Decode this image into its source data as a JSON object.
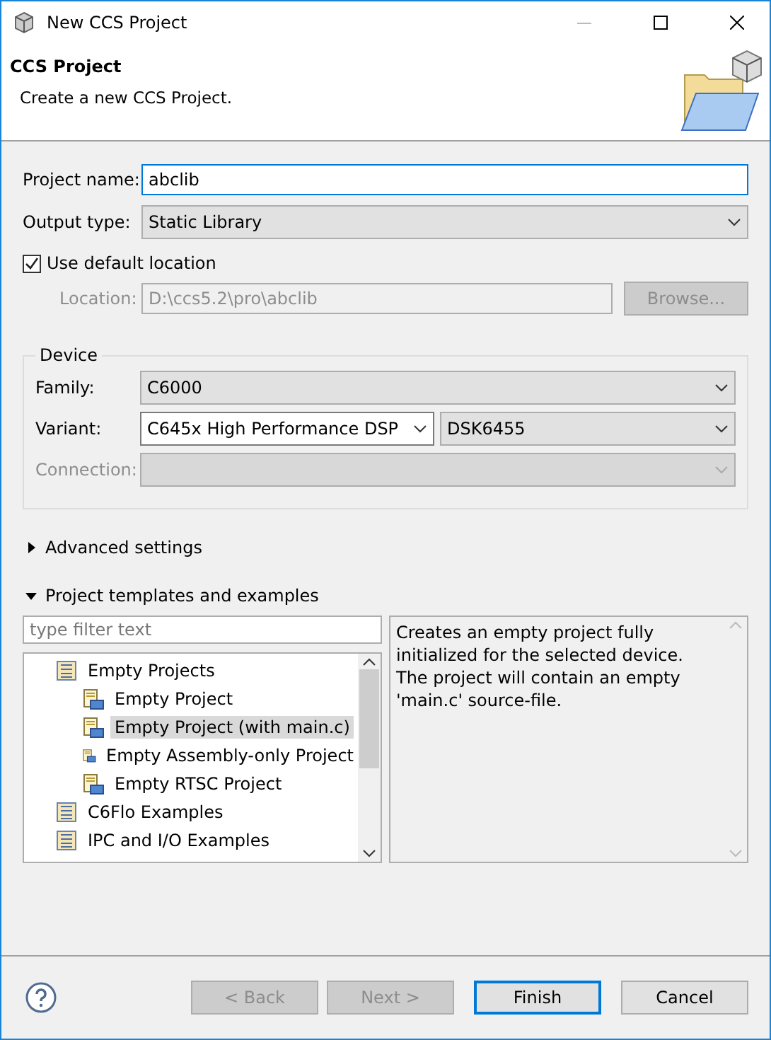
{
  "window": {
    "title": "New CCS Project"
  },
  "header": {
    "title": "CCS Project",
    "subtitle": "Create a new CCS Project."
  },
  "project_name": {
    "label": "Project name:",
    "value": "abclib"
  },
  "output_type": {
    "label": "Output type:",
    "value": "Static Library"
  },
  "use_default_location": {
    "label": "Use default location",
    "checked": true
  },
  "location": {
    "label": "Location:",
    "value": "D:\\ccs5.2\\pro\\abclib",
    "disabled": true,
    "button": "Browse..."
  },
  "device": {
    "title": "Device",
    "family": {
      "label": "Family:",
      "value": "C6000"
    },
    "variant": {
      "label": "Variant:",
      "value": "C645x High Performance DSP",
      "board": "DSK6455"
    },
    "connection": {
      "label": "Connection:",
      "disabled": true
    }
  },
  "advanced": {
    "label": "Advanced settings",
    "expanded": false
  },
  "templates": {
    "label": "Project templates and examples",
    "expanded": true,
    "filter": {
      "placeholder": "type filter text"
    },
    "tree": [
      {
        "label": "Empty Projects",
        "kind": "group",
        "selected": false,
        "children": [
          {
            "label": "Empty Project",
            "kind": "template",
            "selected": false
          },
          {
            "label": "Empty Project (with main.c)",
            "kind": "template",
            "selected": true
          },
          {
            "label": "Empty Assembly-only Project",
            "kind": "template",
            "selected": false
          },
          {
            "label": "Empty RTSC Project",
            "kind": "template",
            "selected": false
          }
        ]
      },
      {
        "label": "C6Flo Examples",
        "kind": "group",
        "selected": false
      },
      {
        "label": "IPC and I/O Examples",
        "kind": "group",
        "selected": false
      }
    ],
    "description": "Creates an empty project fully initialized for the selected device. The project will contain an empty 'main.c' source-file."
  },
  "buttons": [
    {
      "label": "< Back",
      "disabled": true,
      "default": false
    },
    {
      "label": "Next >",
      "disabled": true,
      "default": false
    },
    {
      "label": "Finish",
      "disabled": false,
      "default": true
    },
    {
      "label": "Cancel",
      "disabled": false,
      "default": false
    }
  ]
}
